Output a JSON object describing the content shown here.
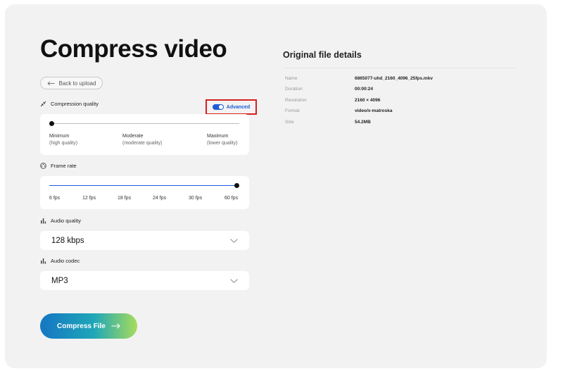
{
  "page_title": "Compress video",
  "back_button": {
    "label": "Back to upload"
  },
  "compression_quality": {
    "label": "Compression quality",
    "advanced_toggle": {
      "label": "Advanced",
      "on": true
    },
    "levels": [
      {
        "name": "Minimum",
        "sub": "(high quality)"
      },
      {
        "name": "Moderate",
        "sub": "(moderate quality)"
      },
      {
        "name": "Maximum",
        "sub": "(lower quality)"
      }
    ],
    "selected_index": 0
  },
  "frame_rate": {
    "label": "Frame rate",
    "options": [
      "6 fps",
      "12 fps",
      "18 fps",
      "24 fps",
      "30 fps",
      "60 fps"
    ],
    "selected_index": 5
  },
  "audio_quality": {
    "label": "Audio quality",
    "value": "128 kbps"
  },
  "audio_codec": {
    "label": "Audio codec",
    "value": "MP3"
  },
  "compress_button": {
    "label": "Compress File"
  },
  "details": {
    "title": "Original file details",
    "rows": [
      {
        "key": "Name",
        "value": "6865077-uhd_2160_4096_25fps.mkv"
      },
      {
        "key": "Duration",
        "value": "00:00:24"
      },
      {
        "key": "Resolution",
        "value": "2160 × 4096"
      },
      {
        "key": "Format",
        "value": "video/x-matroska"
      },
      {
        "key": "Size",
        "value": "54.2MB"
      }
    ]
  },
  "colors": {
    "accent": "#1f5bd8",
    "highlight_border": "#d81f1f",
    "card_bg": "#f2f2f2"
  }
}
